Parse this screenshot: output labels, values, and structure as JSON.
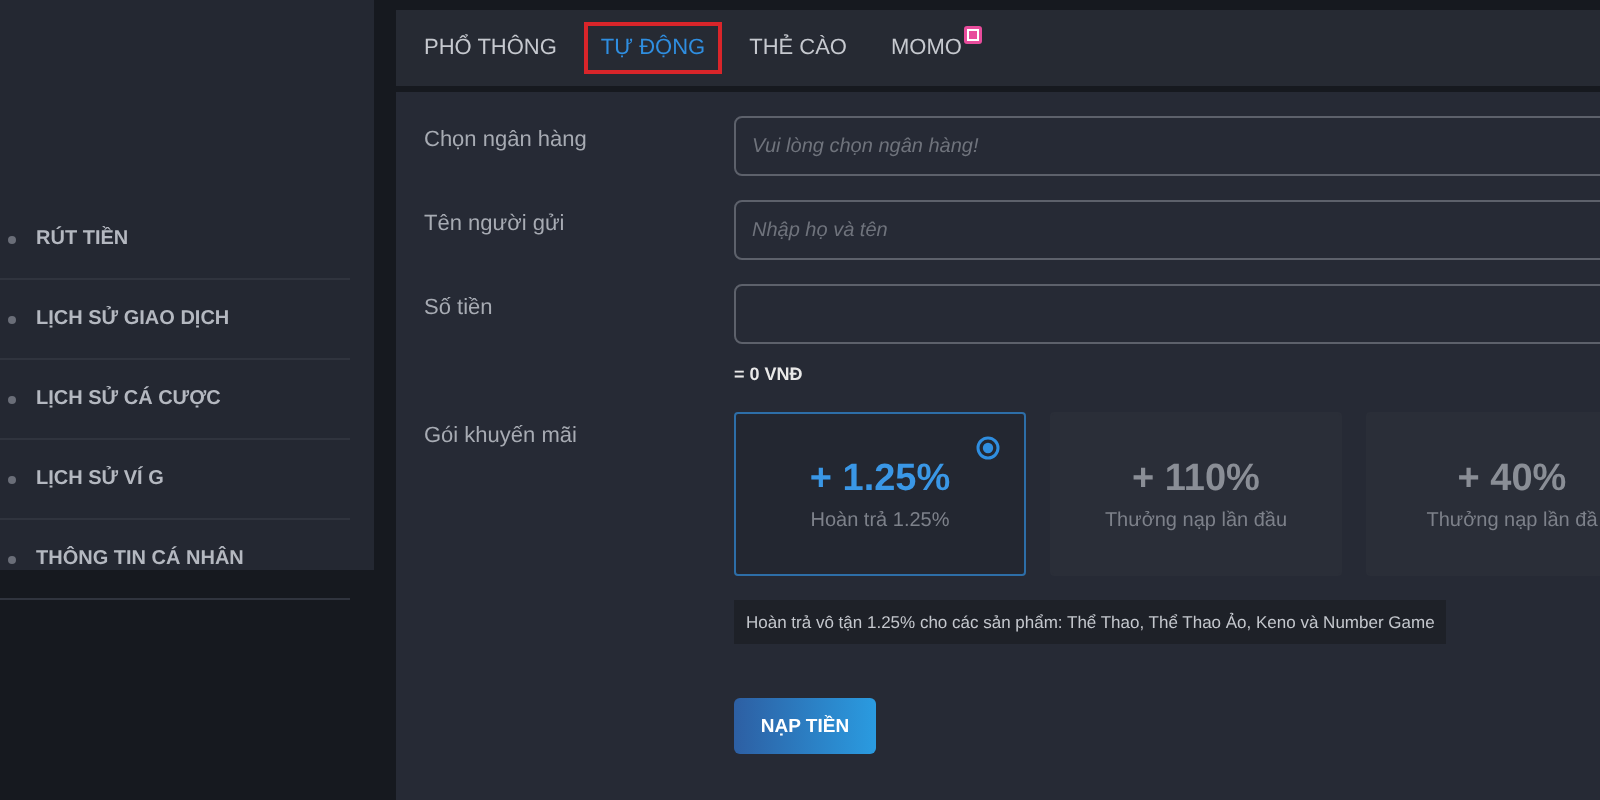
{
  "sidebar": {
    "items": [
      {
        "label": "RÚT TIỀN"
      },
      {
        "label": "LỊCH SỬ GIAO DỊCH"
      },
      {
        "label": "LỊCH SỬ CÁ CƯỢC"
      },
      {
        "label": "LỊCH SỬ VÍ G"
      },
      {
        "label": "THÔNG TIN CÁ NHÂN"
      }
    ]
  },
  "tabs": [
    {
      "label": "PHỔ THÔNG",
      "selected": false,
      "badge": false
    },
    {
      "label": "TỰ ĐỘNG",
      "selected": true,
      "badge": false
    },
    {
      "label": "THẺ CÀO",
      "selected": false,
      "badge": false
    },
    {
      "label": "MOMO",
      "selected": false,
      "badge": true
    }
  ],
  "form": {
    "fields": [
      {
        "label": "Chọn ngân hàng",
        "placeholder": "Vui lòng chọn ngân hàng!"
      },
      {
        "label": "Tên người gửi",
        "placeholder": "Nhập họ và tên"
      },
      {
        "label": "Số tiền"
      }
    ],
    "amount_note": "= 0 VNĐ",
    "promo_label": "Gói khuyến mãi",
    "promos": [
      {
        "value": "+ 1.25%",
        "caption": "Hoàn trả 1.25%",
        "selected": true
      },
      {
        "value": "+ 110%",
        "caption": "Thưởng nạp lần đầu",
        "selected": false
      },
      {
        "value": "+ 40%",
        "caption": "Thưởng nạp lần đầ",
        "selected": false
      }
    ],
    "promo_tooltip": "Hoàn trả vô tận 1.25% cho các sản phẩm: Thể Thao, Thể Thao Ảo, Keno và Number Game",
    "submit": "NẠP TIỀN"
  }
}
